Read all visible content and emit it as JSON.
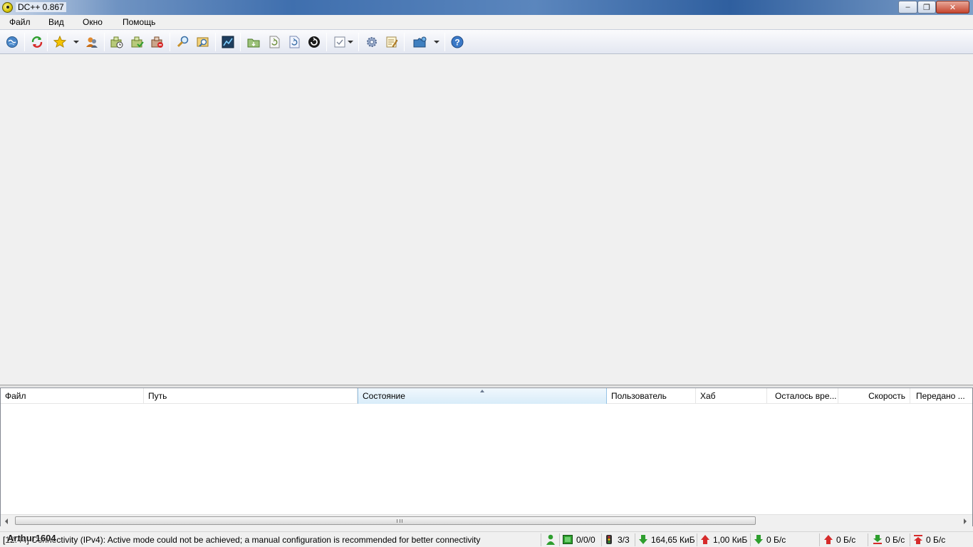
{
  "window": {
    "title": "DC++ 0.867",
    "minimize_label": "–",
    "maximize_label": "❐",
    "close_label": "✕"
  },
  "menu": {
    "items": [
      "Файл",
      "Вид",
      "Окно",
      "Помощь"
    ]
  },
  "toolbar": {
    "buttons": [
      "public-hubs-icon",
      "reconnect-icon",
      "favorite-hubs-icon",
      "favorite-users-icon",
      "download-queue-icon",
      "finished-downloads-icon",
      "upload-queue-icon",
      "search-icon",
      "adl-search-icon",
      "search-spy-icon",
      "open-file-list-icon",
      "refresh-file-list-icon",
      "match-queue-icon",
      "away-icon",
      "notepad-icon",
      "settings-icon",
      "system-log-icon",
      "plugins-icon",
      "help-icon"
    ]
  },
  "transfers": {
    "columns": [
      "Файл",
      "Путь",
      "Состояние",
      "Пользователь",
      "Хаб",
      "Осталось вре...",
      "Скорость",
      "Передано ..."
    ],
    "sorted_column": "Состояние",
    "rows": []
  },
  "status": {
    "message": "[12:44] Connectivity (IPv4): Active mode could not be achieved; a manual configuration is recommended for better connectivity",
    "hubs": "0/0/0",
    "slots": "3/3",
    "downloaded": "164,65 КиБ",
    "uploaded": "1,00 КиБ",
    "down_speed": "0 Б/с",
    "up_speed": "0 Б/с",
    "down_limit": "0 Б/с",
    "up_limit": "0 Б/с"
  },
  "watermark": "Arthur1604",
  "colors": {
    "accent": "#3f6fae",
    "green": "#2e9e2e",
    "red": "#d62b2b"
  }
}
